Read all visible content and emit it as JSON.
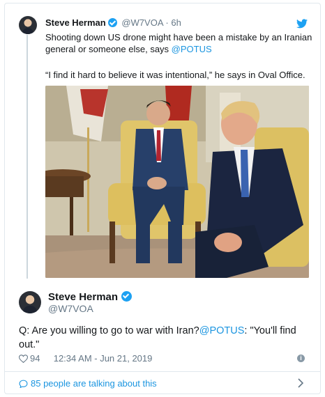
{
  "quoted_tweet": {
    "author_name": "Steve Herman",
    "handle": "@W7VOA",
    "separator": "·",
    "time": "6h",
    "text_before_mention": "Shooting down US drone might have been a mistake by an Iranian general or someone else, says ",
    "mention": "@POTUS",
    "text_line_two": "“I find it hard to believe it was intentional,” he says in Oval Office.",
    "photo_icon": "photo-oval-office-meeting"
  },
  "main_tweet": {
    "author_name": "Steve Herman",
    "handle": "@W7VOA",
    "text_before_mention": "Q: Are you willing to go to war with Iran?",
    "mention": "@POTUS",
    "text_after_mention": ": \"You'll find out.\"",
    "likes": "94",
    "timestamp": "12:34 AM - Jun 21, 2019"
  },
  "footer": {
    "talking_text": "85 people are talking about this"
  },
  "icons": [
    "verified-icon",
    "twitter-bird-icon",
    "heart-icon",
    "info-icon",
    "speech-bubble-icon",
    "chevron-right-icon"
  ],
  "colors": {
    "link": "#1b95e0",
    "twitter_blue": "#1da1f2",
    "muted_text": "#657786",
    "border": "#e1e8ed"
  }
}
